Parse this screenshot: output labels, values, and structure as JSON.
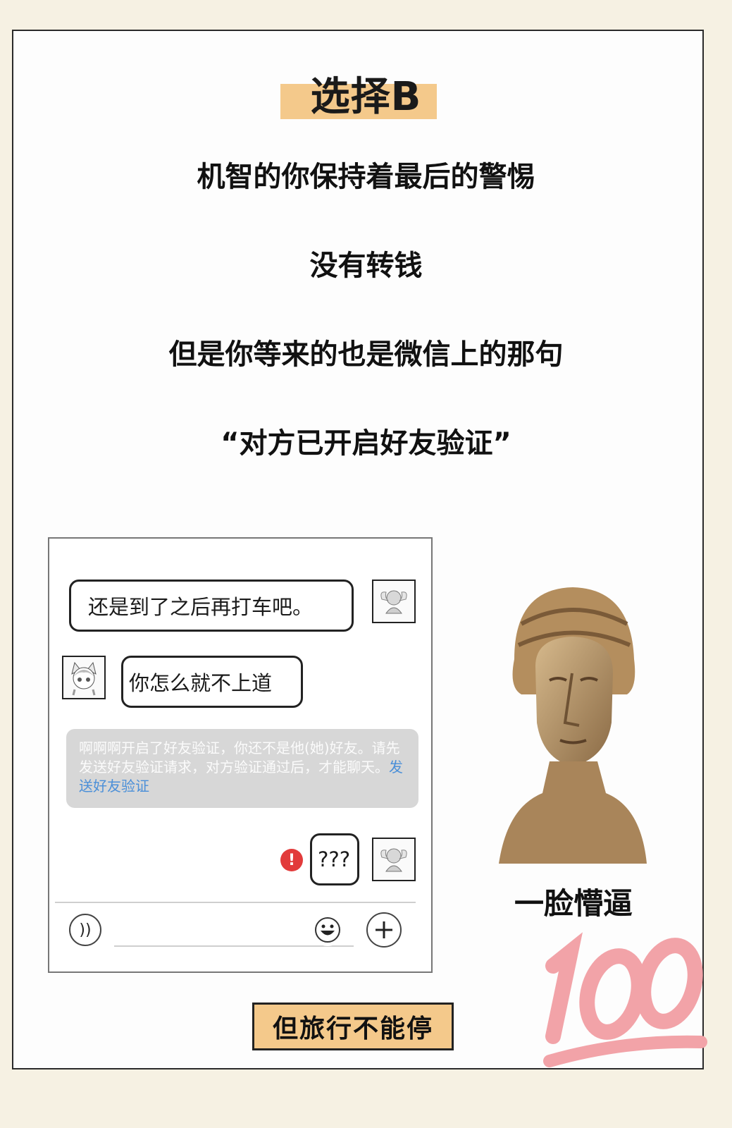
{
  "heading": {
    "title": "选择B"
  },
  "lines": [
    "机智的你保持着最后的警惕",
    "没有转钱",
    "但是你等来的也是微信上的那句",
    "“对方已开启好友验证”"
  ],
  "chat": {
    "message_sent": "还是到了之后再打车吧。",
    "message_received": "你怎么就不上道",
    "notice_text": "啊啊啊开启了好友验证，你还不是他(她)好友。请先发送好友验证请求，对方验证通过后，才能聊天。",
    "notice_link": "发送好友验证",
    "message_failed": "???",
    "error_mark": "!"
  },
  "reaction": {
    "caption": "一脸懵逼"
  },
  "footer": {
    "button_label": "但旅行不能停"
  },
  "colors": {
    "highlight": "#f4c98b",
    "link": "#4a8fd8",
    "error": "#e23b3b",
    "hundred": "#f2a3a8"
  }
}
